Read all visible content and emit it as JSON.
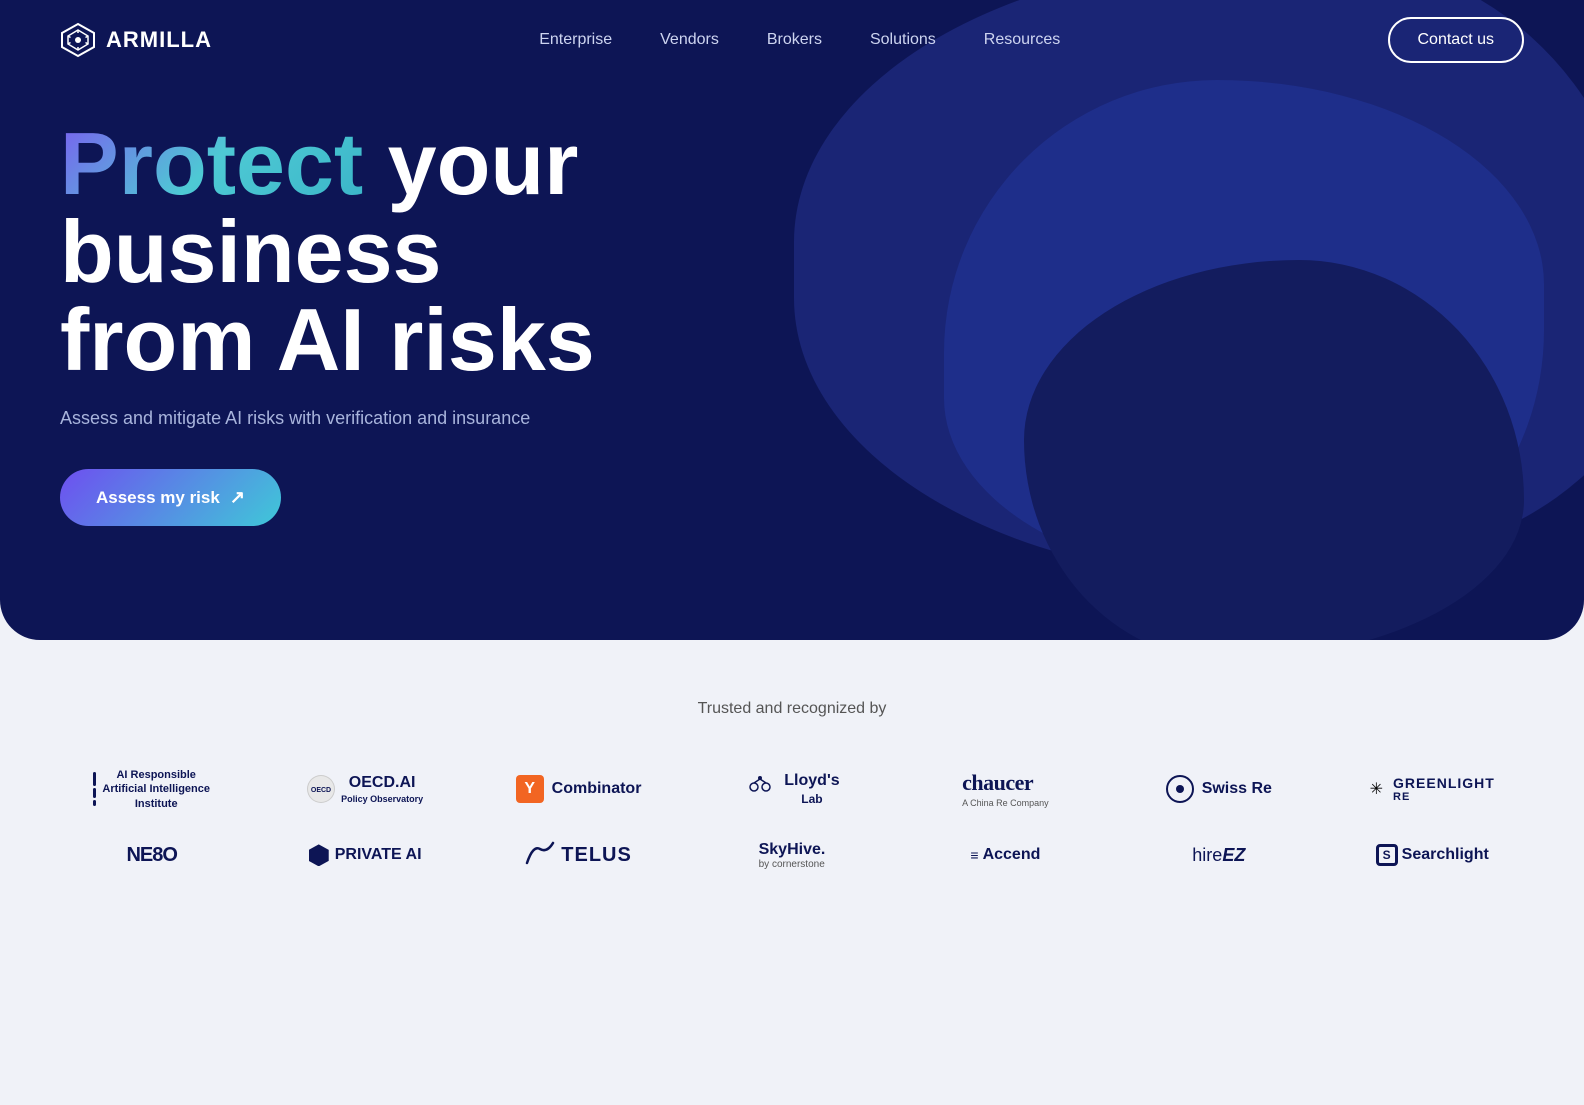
{
  "nav": {
    "logo_text": "ARMILLA",
    "links": [
      {
        "label": "Enterprise",
        "href": "#"
      },
      {
        "label": "Vendors",
        "href": "#"
      },
      {
        "label": "Brokers",
        "href": "#"
      },
      {
        "label": "Solutions",
        "href": "#"
      },
      {
        "label": "Resources",
        "href": "#"
      }
    ],
    "cta_label": "Contact us"
  },
  "hero": {
    "title_highlight": "Protect",
    "title_rest_1": " your",
    "title_line2": "business",
    "title_line3": "from AI risks",
    "subtitle": "Assess and mitigate AI risks with verification and insurance",
    "cta_label": "Assess my risk",
    "cta_arrow": "↗"
  },
  "trusted": {
    "title": "Trusted and recognized by",
    "row1": [
      {
        "id": "rai",
        "name": "Responsible Artificial Intelligence Institute"
      },
      {
        "id": "oecd",
        "name": "OECD.AI Policy Observatory"
      },
      {
        "id": "ycombinator",
        "name": "Y Combinator"
      },
      {
        "id": "lloyds",
        "name": "Lloyd's Lab"
      },
      {
        "id": "chaucer",
        "name": "chaucer",
        "sub": "A China Re Company"
      },
      {
        "id": "swissre",
        "name": "Swiss Re"
      },
      {
        "id": "greenlight",
        "name": "GREENLIGHT RE"
      }
    ],
    "row2": [
      {
        "id": "one80",
        "name": "ONE80"
      },
      {
        "id": "privateai",
        "name": "PRIVATE AI"
      },
      {
        "id": "telus",
        "name": "TELUS"
      },
      {
        "id": "skyhive",
        "name": "SkyHive.",
        "sub": "by cornerstone"
      },
      {
        "id": "accend",
        "name": "Accend"
      },
      {
        "id": "hireez",
        "name": "hireEZ"
      },
      {
        "id": "searchlight",
        "name": "Searchlight"
      }
    ]
  }
}
